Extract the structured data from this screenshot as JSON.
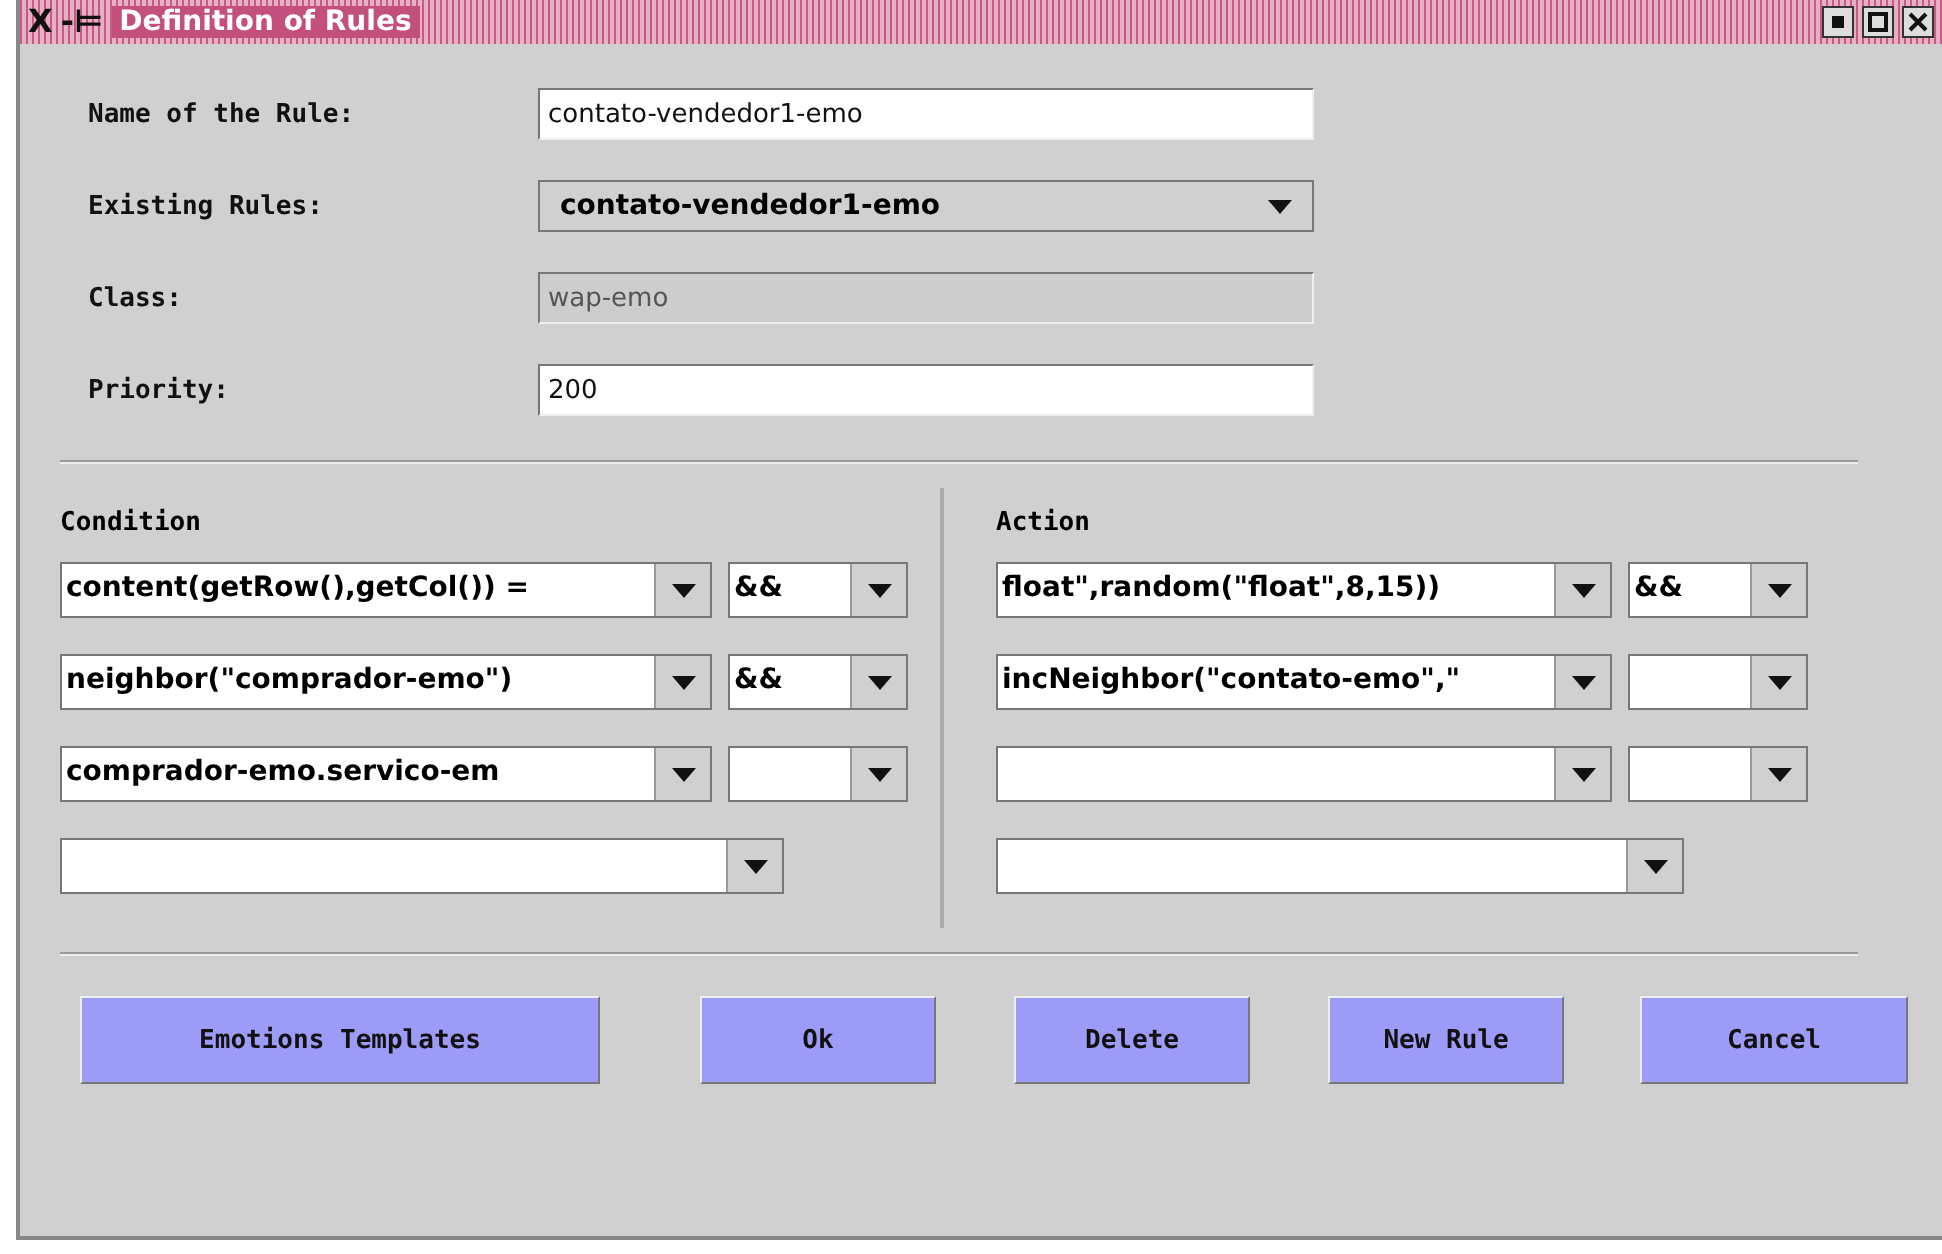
{
  "window": {
    "title": "Definition of Rules",
    "menu_glyph": "X",
    "pin_glyph": "-⊨"
  },
  "fields": [
    {
      "label": "Name of the Rule:",
      "kind": "text",
      "value": "contato-vendedor1-emo",
      "disabled": false
    },
    {
      "label": "Existing Rules:",
      "kind": "combo",
      "value": "contato-vendedor1-emo"
    },
    {
      "label": "Class:",
      "kind": "text",
      "value": "wap-emo",
      "disabled": true
    },
    {
      "label": "Priority:",
      "kind": "text",
      "value": "200",
      "disabled": false
    }
  ],
  "condition": {
    "title": "Condition",
    "rows": [
      {
        "kind": "with-operator",
        "value": "content(getRow(),getCol()) = ",
        "operator": "&&"
      },
      {
        "kind": "with-operator",
        "value": "neighbor(\"comprador-emo\")",
        "operator": "&&"
      },
      {
        "kind": "with-operator",
        "value": "comprador-emo.servico-em"
      },
      {
        "kind": "single"
      }
    ]
  },
  "action": {
    "title": "Action",
    "rows": [
      {
        "kind": "with-operator",
        "value": "float\",random(\"float\",8,15))",
        "operator": "&&"
      },
      {
        "kind": "with-operator",
        "value": "incNeighbor(\"contato-emo\",\""
      },
      {
        "kind": "with-operator"
      },
      {
        "kind": "single"
      }
    ]
  },
  "buttons": [
    "Emotions Templates",
    "Ok",
    "Delete",
    "New Rule",
    "Cancel"
  ]
}
